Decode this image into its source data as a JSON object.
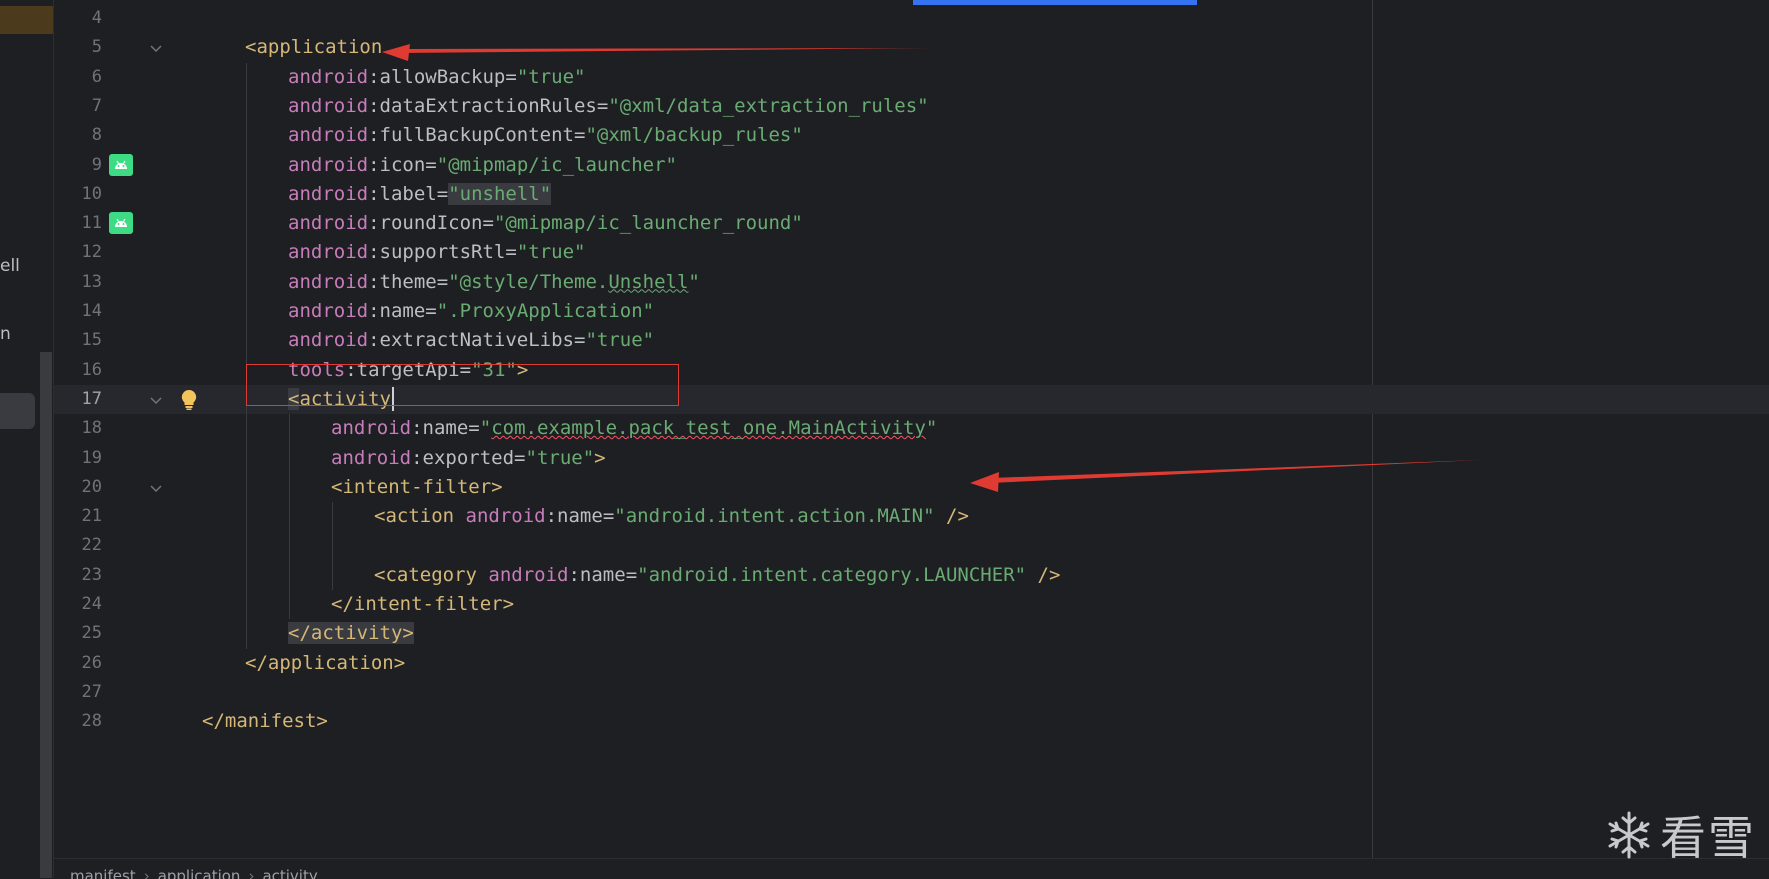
{
  "left_panel": {
    "fragments": [
      "ell",
      "n"
    ]
  },
  "editor": {
    "lines": [
      {
        "num": "4",
        "html": ""
      },
      {
        "num": "5",
        "fold": true,
        "indent": 1,
        "segments": [
          [
            "tag",
            "<application"
          ]
        ]
      },
      {
        "num": "6",
        "indent": 2,
        "segments": [
          [
            "ns",
            "android"
          ],
          [
            "punct",
            ":"
          ],
          [
            "attr",
            "allowBackup"
          ],
          [
            "punct",
            "="
          ],
          [
            "val",
            "\"true\""
          ]
        ]
      },
      {
        "num": "7",
        "indent": 2,
        "segments": [
          [
            "ns",
            "android"
          ],
          [
            "punct",
            ":"
          ],
          [
            "attr",
            "dataExtractionRules"
          ],
          [
            "punct",
            "="
          ],
          [
            "val",
            "\"@xml/data_extraction_rules\""
          ]
        ]
      },
      {
        "num": "8",
        "indent": 2,
        "segments": [
          [
            "ns",
            "android"
          ],
          [
            "punct",
            ":"
          ],
          [
            "attr",
            "fullBackupContent"
          ],
          [
            "punct",
            "="
          ],
          [
            "val",
            "\"@xml/backup_rules\""
          ]
        ]
      },
      {
        "num": "9",
        "icon": "android-icon",
        "indent": 2,
        "segments": [
          [
            "ns",
            "android"
          ],
          [
            "punct",
            ":"
          ],
          [
            "attr",
            "icon"
          ],
          [
            "punct",
            "="
          ],
          [
            "val",
            "\"@mipmap/ic_launcher\""
          ]
        ]
      },
      {
        "num": "10",
        "indent": 2,
        "segments": [
          [
            "ns",
            "android"
          ],
          [
            "punct",
            ":"
          ],
          [
            "attr",
            "label"
          ],
          [
            "punct",
            "="
          ],
          [
            "val hl-bg",
            "\"unshell\""
          ]
        ]
      },
      {
        "num": "11",
        "icon": "android-icon",
        "indent": 2,
        "segments": [
          [
            "ns",
            "android"
          ],
          [
            "punct",
            ":"
          ],
          [
            "attr",
            "roundIcon"
          ],
          [
            "punct",
            "="
          ],
          [
            "val",
            "\"@mipmap/ic_launcher_round\""
          ]
        ]
      },
      {
        "num": "12",
        "indent": 2,
        "segments": [
          [
            "ns",
            "android"
          ],
          [
            "punct",
            ":"
          ],
          [
            "attr",
            "supportsRtl"
          ],
          [
            "punct",
            "="
          ],
          [
            "val",
            "\"true\""
          ]
        ]
      },
      {
        "num": "13",
        "indent": 2,
        "segments": [
          [
            "ns",
            "android"
          ],
          [
            "punct",
            ":"
          ],
          [
            "attr",
            "theme"
          ],
          [
            "punct",
            "="
          ],
          [
            "val",
            "\"@style/Theme."
          ],
          [
            "val typo",
            "Unshell"
          ],
          [
            "val",
            "\""
          ]
        ]
      },
      {
        "num": "14",
        "indent": 2,
        "segments": [
          [
            "ns",
            "android"
          ],
          [
            "punct",
            ":"
          ],
          [
            "attr",
            "name"
          ],
          [
            "punct",
            "="
          ],
          [
            "val",
            "\".ProxyApplication\""
          ]
        ]
      },
      {
        "num": "15",
        "indent": 2,
        "segments": [
          [
            "ns",
            "android"
          ],
          [
            "punct",
            ":"
          ],
          [
            "attr",
            "extractNativeLibs"
          ],
          [
            "punct",
            "="
          ],
          [
            "val",
            "\"true\""
          ]
        ]
      },
      {
        "num": "16",
        "indent": 2,
        "segments": [
          [
            "ns",
            "tools"
          ],
          [
            "punct",
            ":"
          ],
          [
            "attr",
            "targetApi"
          ],
          [
            "punct",
            "="
          ],
          [
            "val",
            "\"31\""
          ],
          [
            "tag",
            ">"
          ]
        ]
      },
      {
        "num": "17",
        "fold": true,
        "bulb": true,
        "current": true,
        "indent": 2,
        "segments": [
          [
            "tag hl-bg",
            "<"
          ],
          [
            "tag",
            "activity"
          ]
        ],
        "caret": true
      },
      {
        "num": "18",
        "indent": 3,
        "segments": [
          [
            "ns",
            "android"
          ],
          [
            "punct",
            ":"
          ],
          [
            "attr",
            "name"
          ],
          [
            "punct",
            "="
          ],
          [
            "val",
            "\""
          ],
          [
            "val err",
            "com.example."
          ],
          [
            "val err",
            "pack_test_one"
          ],
          [
            "val err",
            ".MainActivity"
          ],
          [
            "val",
            "\""
          ]
        ]
      },
      {
        "num": "19",
        "indent": 3,
        "segments": [
          [
            "ns",
            "android"
          ],
          [
            "punct",
            ":"
          ],
          [
            "attr",
            "exported"
          ],
          [
            "punct",
            "="
          ],
          [
            "val",
            "\"true\""
          ],
          [
            "tag",
            ">"
          ]
        ]
      },
      {
        "num": "20",
        "fold": true,
        "indent": 3,
        "segments": [
          [
            "tag",
            "<intent-filter>"
          ]
        ]
      },
      {
        "num": "21",
        "indent": 4,
        "segments": [
          [
            "tag",
            "<action "
          ],
          [
            "ns",
            "android"
          ],
          [
            "punct",
            ":"
          ],
          [
            "attr",
            "name"
          ],
          [
            "punct",
            "="
          ],
          [
            "val",
            "\"android.intent.action.MAIN\""
          ],
          [
            "tag",
            " />"
          ]
        ]
      },
      {
        "num": "22",
        "indent": 4,
        "segments": []
      },
      {
        "num": "23",
        "indent": 4,
        "segments": [
          [
            "tag",
            "<category "
          ],
          [
            "ns",
            "android"
          ],
          [
            "punct",
            ":"
          ],
          [
            "attr",
            "name"
          ],
          [
            "punct",
            "="
          ],
          [
            "val",
            "\"android.intent.category.LAUNCHER\""
          ],
          [
            "tag",
            " />"
          ]
        ]
      },
      {
        "num": "24",
        "indent": 3,
        "segments": [
          [
            "tag",
            "</intent-filter>"
          ]
        ]
      },
      {
        "num": "25",
        "indent": 2,
        "segments": [
          [
            "tag hl-bg",
            "</activity>"
          ]
        ]
      },
      {
        "num": "26",
        "indent": 1,
        "segments": [
          [
            "tag",
            "</application>"
          ]
        ]
      },
      {
        "num": "27",
        "indent": 0,
        "segments": []
      },
      {
        "num": "28",
        "indent": 0,
        "segments": [
          [
            "tag",
            "</manifest>"
          ]
        ]
      }
    ]
  },
  "breadcrumb": {
    "items": [
      "manifest",
      "application",
      "activity"
    ]
  },
  "watermark": {
    "text": "看雪"
  },
  "colors": {
    "background": "#1e1f22",
    "tag": "#d5b778",
    "namespace": "#c77dbb",
    "value": "#6aab73",
    "annotation": "#e03b32"
  }
}
